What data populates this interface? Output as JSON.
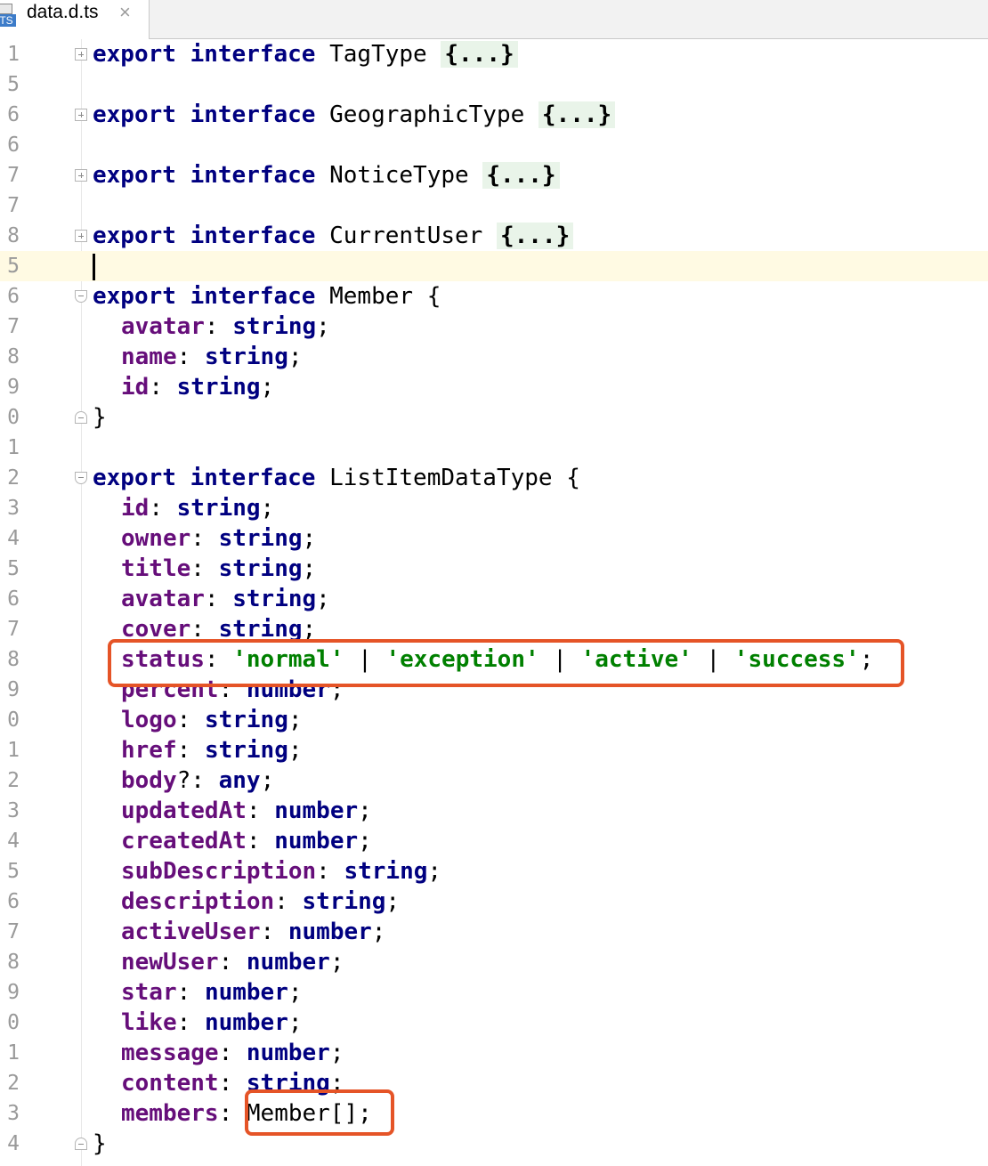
{
  "tab": {
    "label": "data.d.ts",
    "close": "×",
    "file_badge": "TS"
  },
  "lines": [
    {
      "ln": "1",
      "fold": "plus",
      "tokens": [
        [
          "kw",
          "export"
        ],
        [
          "plain",
          " "
        ],
        [
          "kw",
          "interface"
        ],
        [
          "plain",
          " TagType "
        ],
        [
          "folded",
          "{...}"
        ]
      ]
    },
    {
      "ln": "5",
      "fold": "",
      "tokens": []
    },
    {
      "ln": "6",
      "fold": "plus",
      "tokens": [
        [
          "kw",
          "export"
        ],
        [
          "plain",
          " "
        ],
        [
          "kw",
          "interface"
        ],
        [
          "plain",
          " GeographicType "
        ],
        [
          "folded",
          "{...}"
        ]
      ]
    },
    {
      "ln": "6",
      "fold": "",
      "tokens": []
    },
    {
      "ln": "7",
      "fold": "plus",
      "tokens": [
        [
          "kw",
          "export"
        ],
        [
          "plain",
          " "
        ],
        [
          "kw",
          "interface"
        ],
        [
          "plain",
          " NoticeType "
        ],
        [
          "folded",
          "{...}"
        ]
      ]
    },
    {
      "ln": "7",
      "fold": "",
      "tokens": []
    },
    {
      "ln": "8",
      "fold": "plus",
      "tokens": [
        [
          "kw",
          "export"
        ],
        [
          "plain",
          " "
        ],
        [
          "kw",
          "interface"
        ],
        [
          "plain",
          " CurrentUser "
        ],
        [
          "folded",
          "{...}"
        ]
      ]
    },
    {
      "ln": "5",
      "fold": "",
      "current": true,
      "caret": true,
      "tokens": []
    },
    {
      "ln": "6",
      "fold": "open",
      "tokens": [
        [
          "kw",
          "export"
        ],
        [
          "plain",
          " "
        ],
        [
          "kw",
          "interface"
        ],
        [
          "plain",
          " Member {"
        ]
      ]
    },
    {
      "ln": "7",
      "fold": "",
      "indent": true,
      "tokens": [
        [
          "prop",
          "avatar"
        ],
        [
          "plain",
          ": "
        ],
        [
          "type",
          "string"
        ],
        [
          "plain",
          ";"
        ]
      ]
    },
    {
      "ln": "8",
      "fold": "",
      "indent": true,
      "tokens": [
        [
          "prop",
          "name"
        ],
        [
          "plain",
          ": "
        ],
        [
          "type",
          "string"
        ],
        [
          "plain",
          ";"
        ]
      ]
    },
    {
      "ln": "9",
      "fold": "",
      "indent": true,
      "tokens": [
        [
          "prop",
          "id"
        ],
        [
          "plain",
          ": "
        ],
        [
          "type",
          "string"
        ],
        [
          "plain",
          ";"
        ]
      ]
    },
    {
      "ln": "0",
      "fold": "close",
      "tokens": [
        [
          "plain",
          "}"
        ]
      ]
    },
    {
      "ln": "1",
      "fold": "",
      "tokens": []
    },
    {
      "ln": "2",
      "fold": "open",
      "tokens": [
        [
          "kw",
          "export"
        ],
        [
          "plain",
          " "
        ],
        [
          "kw",
          "interface"
        ],
        [
          "plain",
          " ListItemDataType {"
        ]
      ]
    },
    {
      "ln": "3",
      "fold": "",
      "indent": true,
      "tokens": [
        [
          "prop",
          "id"
        ],
        [
          "plain",
          ": "
        ],
        [
          "type",
          "string"
        ],
        [
          "plain",
          ";"
        ]
      ]
    },
    {
      "ln": "4",
      "fold": "",
      "indent": true,
      "tokens": [
        [
          "prop",
          "owner"
        ],
        [
          "plain",
          ": "
        ],
        [
          "type",
          "string"
        ],
        [
          "plain",
          ";"
        ]
      ]
    },
    {
      "ln": "5",
      "fold": "",
      "indent": true,
      "tokens": [
        [
          "prop",
          "title"
        ],
        [
          "plain",
          ": "
        ],
        [
          "type",
          "string"
        ],
        [
          "plain",
          ";"
        ]
      ]
    },
    {
      "ln": "6",
      "fold": "",
      "indent": true,
      "tokens": [
        [
          "prop",
          "avatar"
        ],
        [
          "plain",
          ": "
        ],
        [
          "type",
          "string"
        ],
        [
          "plain",
          ";"
        ]
      ]
    },
    {
      "ln": "7",
      "fold": "",
      "indent": true,
      "tokens": [
        [
          "prop",
          "cover"
        ],
        [
          "plain",
          ": "
        ],
        [
          "type",
          "string"
        ],
        [
          "plain",
          ";"
        ]
      ]
    },
    {
      "ln": "8",
      "fold": "",
      "indent": true,
      "tokens": [
        [
          "prop",
          "status"
        ],
        [
          "plain",
          ": "
        ],
        [
          "str",
          "'normal'"
        ],
        [
          "plain",
          " | "
        ],
        [
          "str",
          "'exception'"
        ],
        [
          "plain",
          " | "
        ],
        [
          "str",
          "'active'"
        ],
        [
          "plain",
          " | "
        ],
        [
          "str",
          "'success'"
        ],
        [
          "plain",
          ";"
        ]
      ]
    },
    {
      "ln": "9",
      "fold": "",
      "indent": true,
      "tokens": [
        [
          "prop",
          "percent"
        ],
        [
          "plain",
          ": "
        ],
        [
          "type",
          "number"
        ],
        [
          "plain",
          ";"
        ]
      ]
    },
    {
      "ln": "0",
      "fold": "",
      "indent": true,
      "tokens": [
        [
          "prop",
          "logo"
        ],
        [
          "plain",
          ": "
        ],
        [
          "type",
          "string"
        ],
        [
          "plain",
          ";"
        ]
      ]
    },
    {
      "ln": "1",
      "fold": "",
      "indent": true,
      "tokens": [
        [
          "prop",
          "href"
        ],
        [
          "plain",
          ": "
        ],
        [
          "type",
          "string"
        ],
        [
          "plain",
          ";"
        ]
      ]
    },
    {
      "ln": "2",
      "fold": "",
      "indent": true,
      "tokens": [
        [
          "prop",
          "body"
        ],
        [
          "plain",
          "?: "
        ],
        [
          "type",
          "any"
        ],
        [
          "plain",
          ";"
        ]
      ]
    },
    {
      "ln": "3",
      "fold": "",
      "indent": true,
      "tokens": [
        [
          "prop",
          "updatedAt"
        ],
        [
          "plain",
          ": "
        ],
        [
          "type",
          "number"
        ],
        [
          "plain",
          ";"
        ]
      ]
    },
    {
      "ln": "4",
      "fold": "",
      "indent": true,
      "tokens": [
        [
          "prop",
          "createdAt"
        ],
        [
          "plain",
          ": "
        ],
        [
          "type",
          "number"
        ],
        [
          "plain",
          ";"
        ]
      ]
    },
    {
      "ln": "5",
      "fold": "",
      "indent": true,
      "tokens": [
        [
          "prop",
          "subDescription"
        ],
        [
          "plain",
          ": "
        ],
        [
          "type",
          "string"
        ],
        [
          "plain",
          ";"
        ]
      ]
    },
    {
      "ln": "6",
      "fold": "",
      "indent": true,
      "tokens": [
        [
          "prop",
          "description"
        ],
        [
          "plain",
          ": "
        ],
        [
          "type",
          "string"
        ],
        [
          "plain",
          ";"
        ]
      ]
    },
    {
      "ln": "7",
      "fold": "",
      "indent": true,
      "tokens": [
        [
          "prop",
          "activeUser"
        ],
        [
          "plain",
          ": "
        ],
        [
          "type",
          "number"
        ],
        [
          "plain",
          ";"
        ]
      ]
    },
    {
      "ln": "8",
      "fold": "",
      "indent": true,
      "tokens": [
        [
          "prop",
          "newUser"
        ],
        [
          "plain",
          ": "
        ],
        [
          "type",
          "number"
        ],
        [
          "plain",
          ";"
        ]
      ]
    },
    {
      "ln": "9",
      "fold": "",
      "indent": true,
      "tokens": [
        [
          "prop",
          "star"
        ],
        [
          "plain",
          ": "
        ],
        [
          "type",
          "number"
        ],
        [
          "plain",
          ";"
        ]
      ]
    },
    {
      "ln": "0",
      "fold": "",
      "indent": true,
      "tokens": [
        [
          "prop",
          "like"
        ],
        [
          "plain",
          ": "
        ],
        [
          "type",
          "number"
        ],
        [
          "plain",
          ";"
        ]
      ]
    },
    {
      "ln": "1",
      "fold": "",
      "indent": true,
      "tokens": [
        [
          "prop",
          "message"
        ],
        [
          "plain",
          ": "
        ],
        [
          "type",
          "number"
        ],
        [
          "plain",
          ";"
        ]
      ]
    },
    {
      "ln": "2",
      "fold": "",
      "indent": true,
      "tokens": [
        [
          "prop",
          "content"
        ],
        [
          "plain",
          ": "
        ],
        [
          "type",
          "string"
        ],
        [
          "plain",
          ";"
        ]
      ]
    },
    {
      "ln": "3",
      "fold": "",
      "indent": true,
      "tokens": [
        [
          "prop",
          "members"
        ],
        [
          "plain",
          ": Member[];"
        ]
      ]
    },
    {
      "ln": "4",
      "fold": "close",
      "tokens": [
        [
          "plain",
          "}"
        ]
      ]
    }
  ],
  "colors": {
    "highlight_box": "#e55427",
    "current_line": "#fffae3",
    "keyword": "#000080",
    "property": "#660e7a",
    "string": "#008000"
  }
}
